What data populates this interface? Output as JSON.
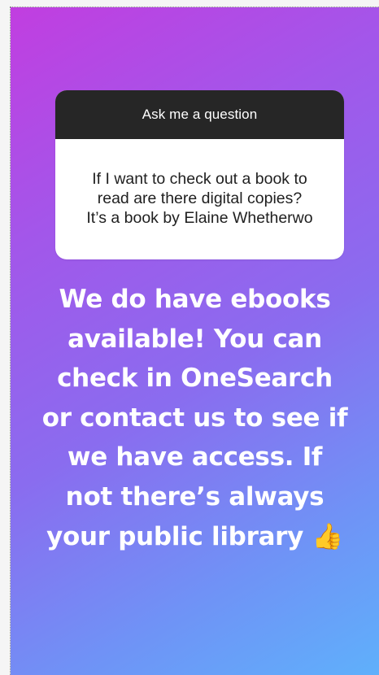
{
  "question_card": {
    "header": "Ask me a question",
    "question": "If I want to check out a book to\nread are there digital copies?\nIt’s a book by Elaine Whetherwo"
  },
  "answer": {
    "text": "We do have ebooks\navailable! You can\ncheck in OneSearch\nor contact us to see if\nwe have access. If\nnot there’s always\nyour public library ",
    "emoji": "👍"
  },
  "icons": {
    "emoji": "thumbs-up-icon"
  },
  "colors": {
    "gradient_start": "#c13ee0",
    "gradient_end": "#5fb0fb",
    "card_header": "#262626",
    "card_body": "#ffffff",
    "answer_text": "#ffffff"
  }
}
